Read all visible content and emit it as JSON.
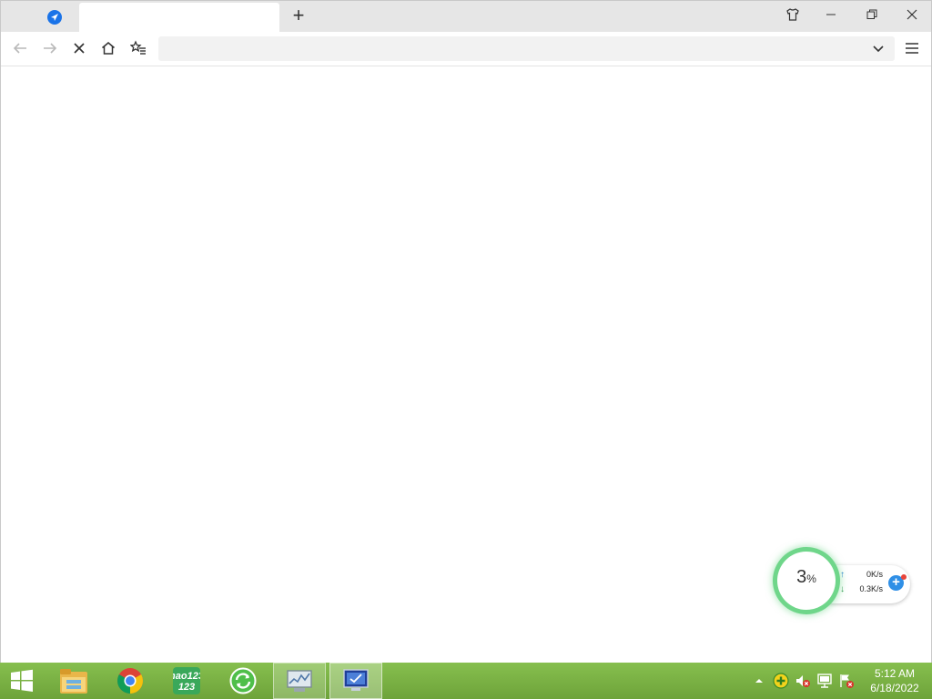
{
  "browser": {
    "tabs": [
      {
        "label": "",
        "icon": "compass-icon",
        "active": false
      },
      {
        "label": "",
        "active": true
      }
    ],
    "new_tab_label": "+",
    "address": {
      "value": "",
      "placeholder": ""
    }
  },
  "net_monitor": {
    "usage_value": "3",
    "usage_unit": "%",
    "upload": "0K/s",
    "download": "0.3K/s",
    "ring_color": "#6fd68a"
  },
  "taskbar": {
    "apps": [
      {
        "name": "start",
        "icon": "windows-logo-icon"
      },
      {
        "name": "file-explorer",
        "icon": "folder-icon"
      },
      {
        "name": "chrome",
        "icon": "chrome-icon"
      },
      {
        "name": "hao123",
        "icon": "hao123-icon",
        "label": "hao123"
      },
      {
        "name": "sync",
        "icon": "sync-icon"
      },
      {
        "name": "resource-monitor",
        "icon": "monitor-chart-icon"
      },
      {
        "name": "screen-app",
        "icon": "screen-icon"
      }
    ],
    "clock": {
      "time": "5:12 AM",
      "date": "6/18/2022"
    },
    "accent": "#7bb444"
  }
}
